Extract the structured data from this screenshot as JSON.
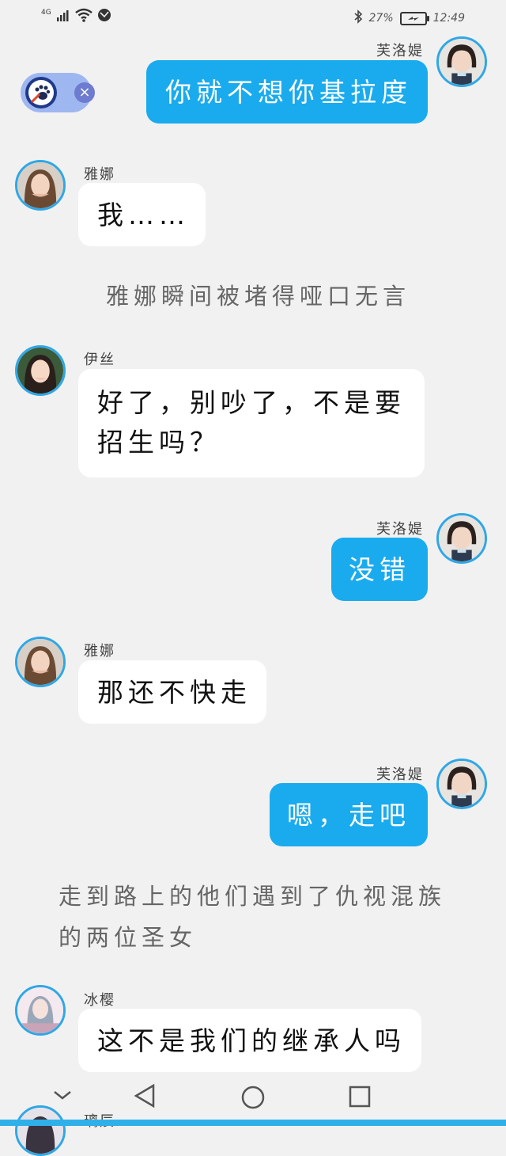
{
  "status_bar": {
    "network": "4G",
    "battery": "27%",
    "time": "12:49"
  },
  "messages": [
    {
      "type": "me",
      "sender": "芙洛媞",
      "text": "你就不想你基拉度"
    },
    {
      "type": "other",
      "sender": "雅娜",
      "text": "我……"
    },
    {
      "type": "narration",
      "text": "雅娜瞬间被堵得哑口无言"
    },
    {
      "type": "other",
      "sender": "伊丝",
      "text": "好了，别吵了，不是要招生吗？"
    },
    {
      "type": "me",
      "sender": "芙洛媞",
      "text": "没错"
    },
    {
      "type": "other",
      "sender": "雅娜",
      "text": "那还不快走"
    },
    {
      "type": "me",
      "sender": "芙洛媞",
      "text": "嗯，走吧"
    },
    {
      "type": "narration",
      "text": "走到路上的他们遇到了仇视混族的两位圣女"
    },
    {
      "type": "other",
      "sender": "冰樱",
      "text": "这不是我们的继承人吗"
    },
    {
      "type": "other",
      "sender": "璃辰",
      "text": ""
    }
  ],
  "narration_lines": {
    "n1": "雅娜瞬间被堵得哑口无言",
    "n2_line1": "走到路上的他们遇到了仇视混族",
    "n2_line2": "的两位圣女"
  },
  "bubble_lines": {
    "m4_line1": "好了，别吵了，不是要",
    "m4_line2": "招生吗？"
  },
  "partial_name": "璃辰",
  "icons": {
    "widget": "paw-icon",
    "widget_close": "close-icon",
    "nav_back": "back-triangle-icon",
    "nav_home": "home-circle-icon",
    "nav_recent": "recent-square-icon",
    "nav_collapse": "chevron-down-icon"
  },
  "colors": {
    "accent": "#1aabee",
    "background": "#f1f1f1",
    "other_bubble": "#ffffff"
  }
}
